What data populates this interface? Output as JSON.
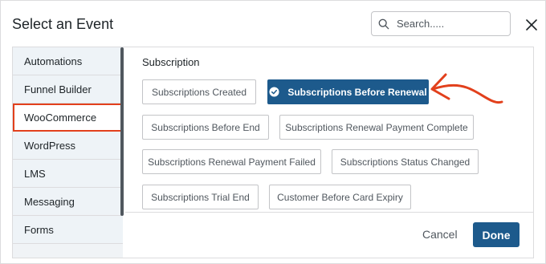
{
  "header": {
    "title": "Select an Event",
    "search_placeholder": "Search....."
  },
  "sidebar": {
    "items": [
      {
        "label": "Automations"
      },
      {
        "label": "Funnel Builder"
      },
      {
        "label": "WooCommerce",
        "active": true
      },
      {
        "label": "WordPress"
      },
      {
        "label": "LMS"
      },
      {
        "label": "Messaging"
      },
      {
        "label": "Forms"
      }
    ]
  },
  "main": {
    "section_title": "Subscription",
    "events": [
      {
        "label": "Subscriptions Created"
      },
      {
        "label": "Subscriptions Before Renewal",
        "selected": true
      },
      {
        "label": "Subscriptions Before End"
      },
      {
        "label": "Subscriptions Renewal Payment Complete"
      },
      {
        "label": "Subscriptions Renewal Payment Failed"
      },
      {
        "label": "Subscriptions Status Changed"
      },
      {
        "label": "Subscriptions Trial End"
      },
      {
        "label": "Customer Before Card Expiry"
      }
    ]
  },
  "footer": {
    "cancel_label": "Cancel",
    "done_label": "Done"
  },
  "colors": {
    "primary": "#1d5a8c",
    "highlight_outline": "#e2401c",
    "annotation_arrow": "#e2401c"
  }
}
